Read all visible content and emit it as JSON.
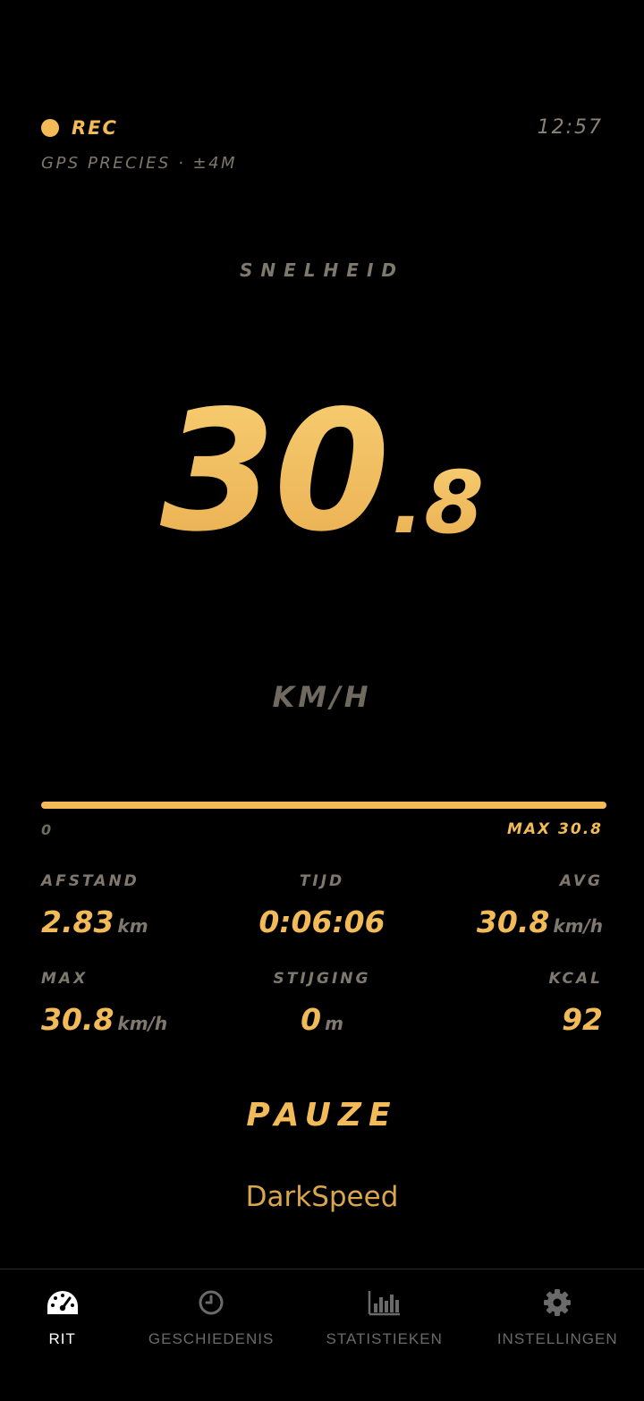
{
  "status": {
    "rec_label": "REC",
    "clock": "12:57",
    "gps": "GPS PRECIES · ±4M"
  },
  "speed": {
    "label": "SNELHEID",
    "integer": "30",
    "decimal": ".8",
    "unit": "KM/H"
  },
  "progress": {
    "min_label": "0",
    "max_label": "MAX 30.8",
    "fill_fraction": 1.0
  },
  "stats": [
    {
      "label": "AFSTAND",
      "value": "2.83",
      "unit": "km"
    },
    {
      "label": "TIJD",
      "value": "0:06:06",
      "unit": ""
    },
    {
      "label": "AVG",
      "value": "30.8",
      "unit": "km/h"
    },
    {
      "label": "MAX",
      "value": "30.8",
      "unit": "km/h"
    },
    {
      "label": "STIJGING",
      "value": "0",
      "unit": "m"
    },
    {
      "label": "KCAL",
      "value": "92",
      "unit": ""
    }
  ],
  "pause_label": "PAUZE",
  "brand": "DarkSpeed",
  "nav": [
    {
      "label": "RIT",
      "icon": "speedometer-icon",
      "active": true
    },
    {
      "label": "GESCHIEDENIS",
      "icon": "clock-icon",
      "active": false
    },
    {
      "label": "STATISTIEKEN",
      "icon": "bar-chart-icon",
      "active": false
    },
    {
      "label": "INSTELLINGEN",
      "icon": "gear-icon",
      "active": false
    }
  ],
  "colors": {
    "accent": "#f2bb57",
    "muted": "#7f786e",
    "background": "#000000"
  }
}
